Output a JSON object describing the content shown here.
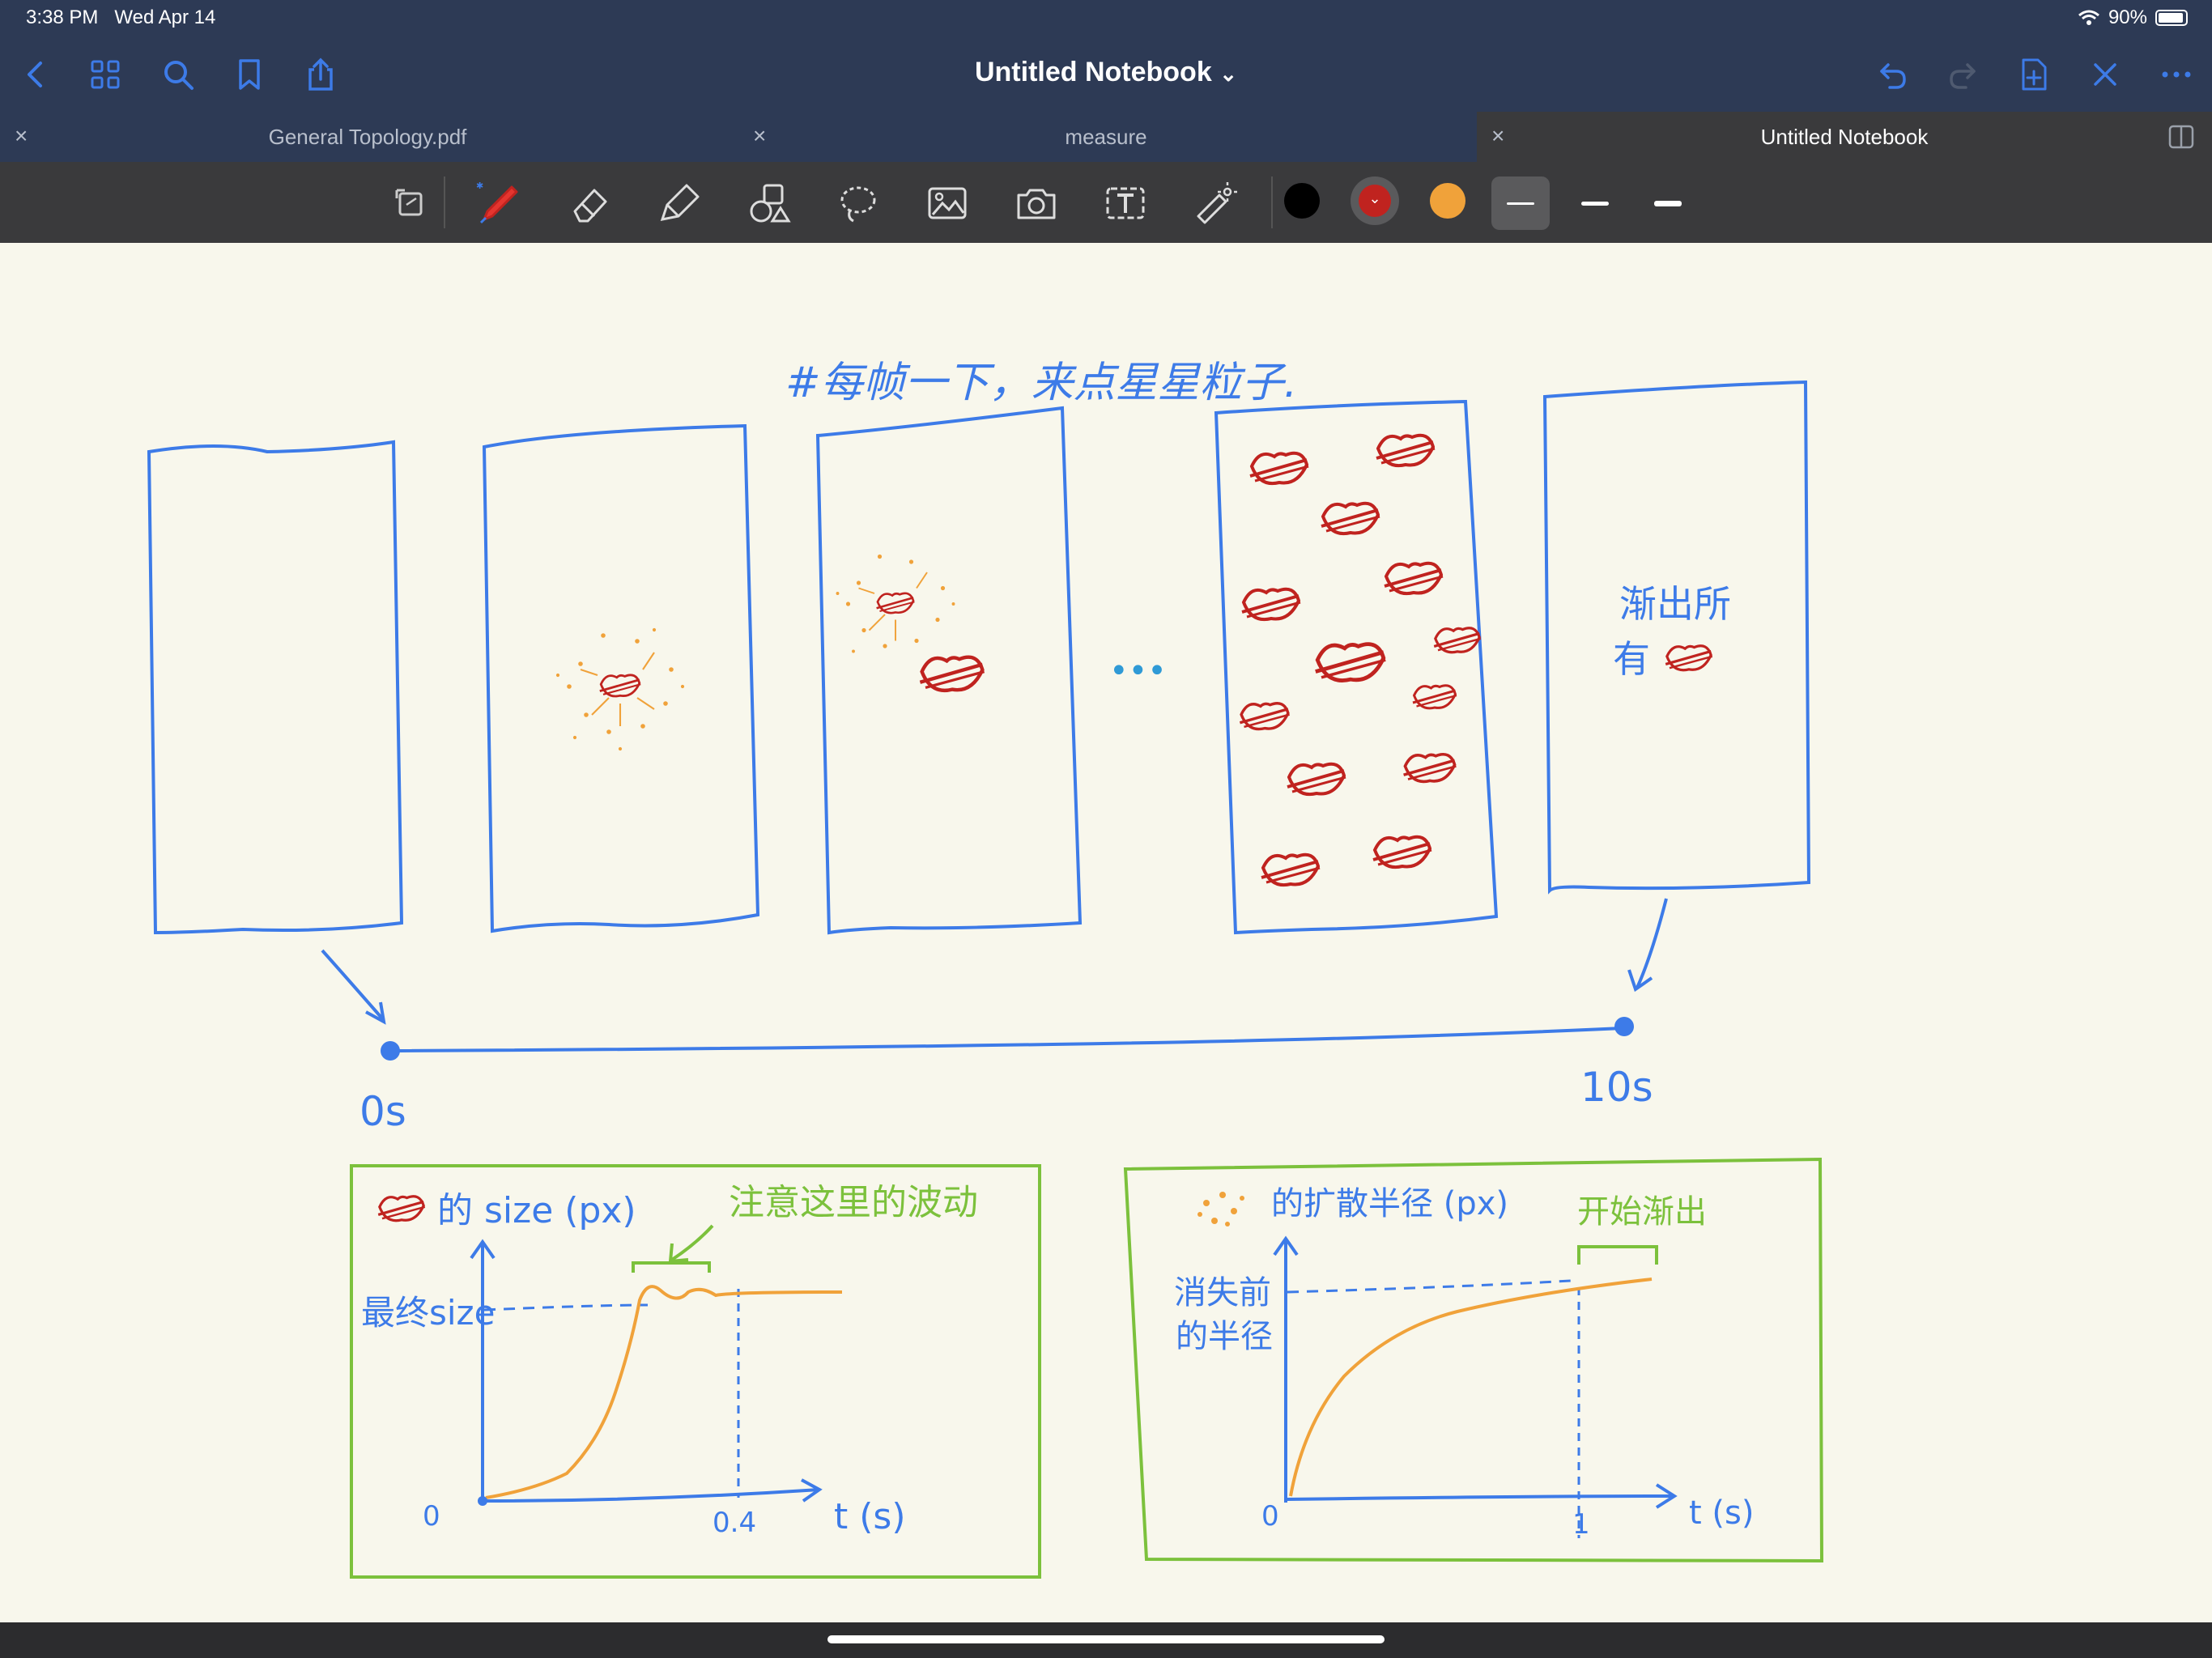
{
  "status": {
    "time": "3:38 PM",
    "date": "Wed Apr 14",
    "battery": "90%"
  },
  "nav": {
    "title": "Untitled Notebook",
    "title_chevron": "⌄"
  },
  "tabs": [
    {
      "label": "General Topology.pdf",
      "close": "×"
    },
    {
      "label": "measure",
      "close": "×"
    },
    {
      "label": "Untitled Notebook",
      "close": "×"
    }
  ],
  "toolbar": {
    "colors": [
      "#000000",
      "#c0231f",
      "#f0a23a"
    ]
  },
  "canvas": {
    "heading": "#每帧一下，来点星星粒子.",
    "fade_text_line1": "渐出所",
    "fade_text_line2": "有",
    "dots": "•••",
    "time_start": "0s",
    "time_end": "10s",
    "chart1": {
      "title": "的 size (px)",
      "note": "注意这里的波动",
      "ylabel": "最终size",
      "origin": "0",
      "xtick": "0.4",
      "xlabel": "t (s)"
    },
    "chart2": {
      "title": "的扩散半径 (px)",
      "note": "开始渐出",
      "ylabel_line1": "消失前",
      "ylabel_line2": "的半径",
      "origin": "0",
      "xtick": "1",
      "xlabel": "t (s)"
    }
  }
}
